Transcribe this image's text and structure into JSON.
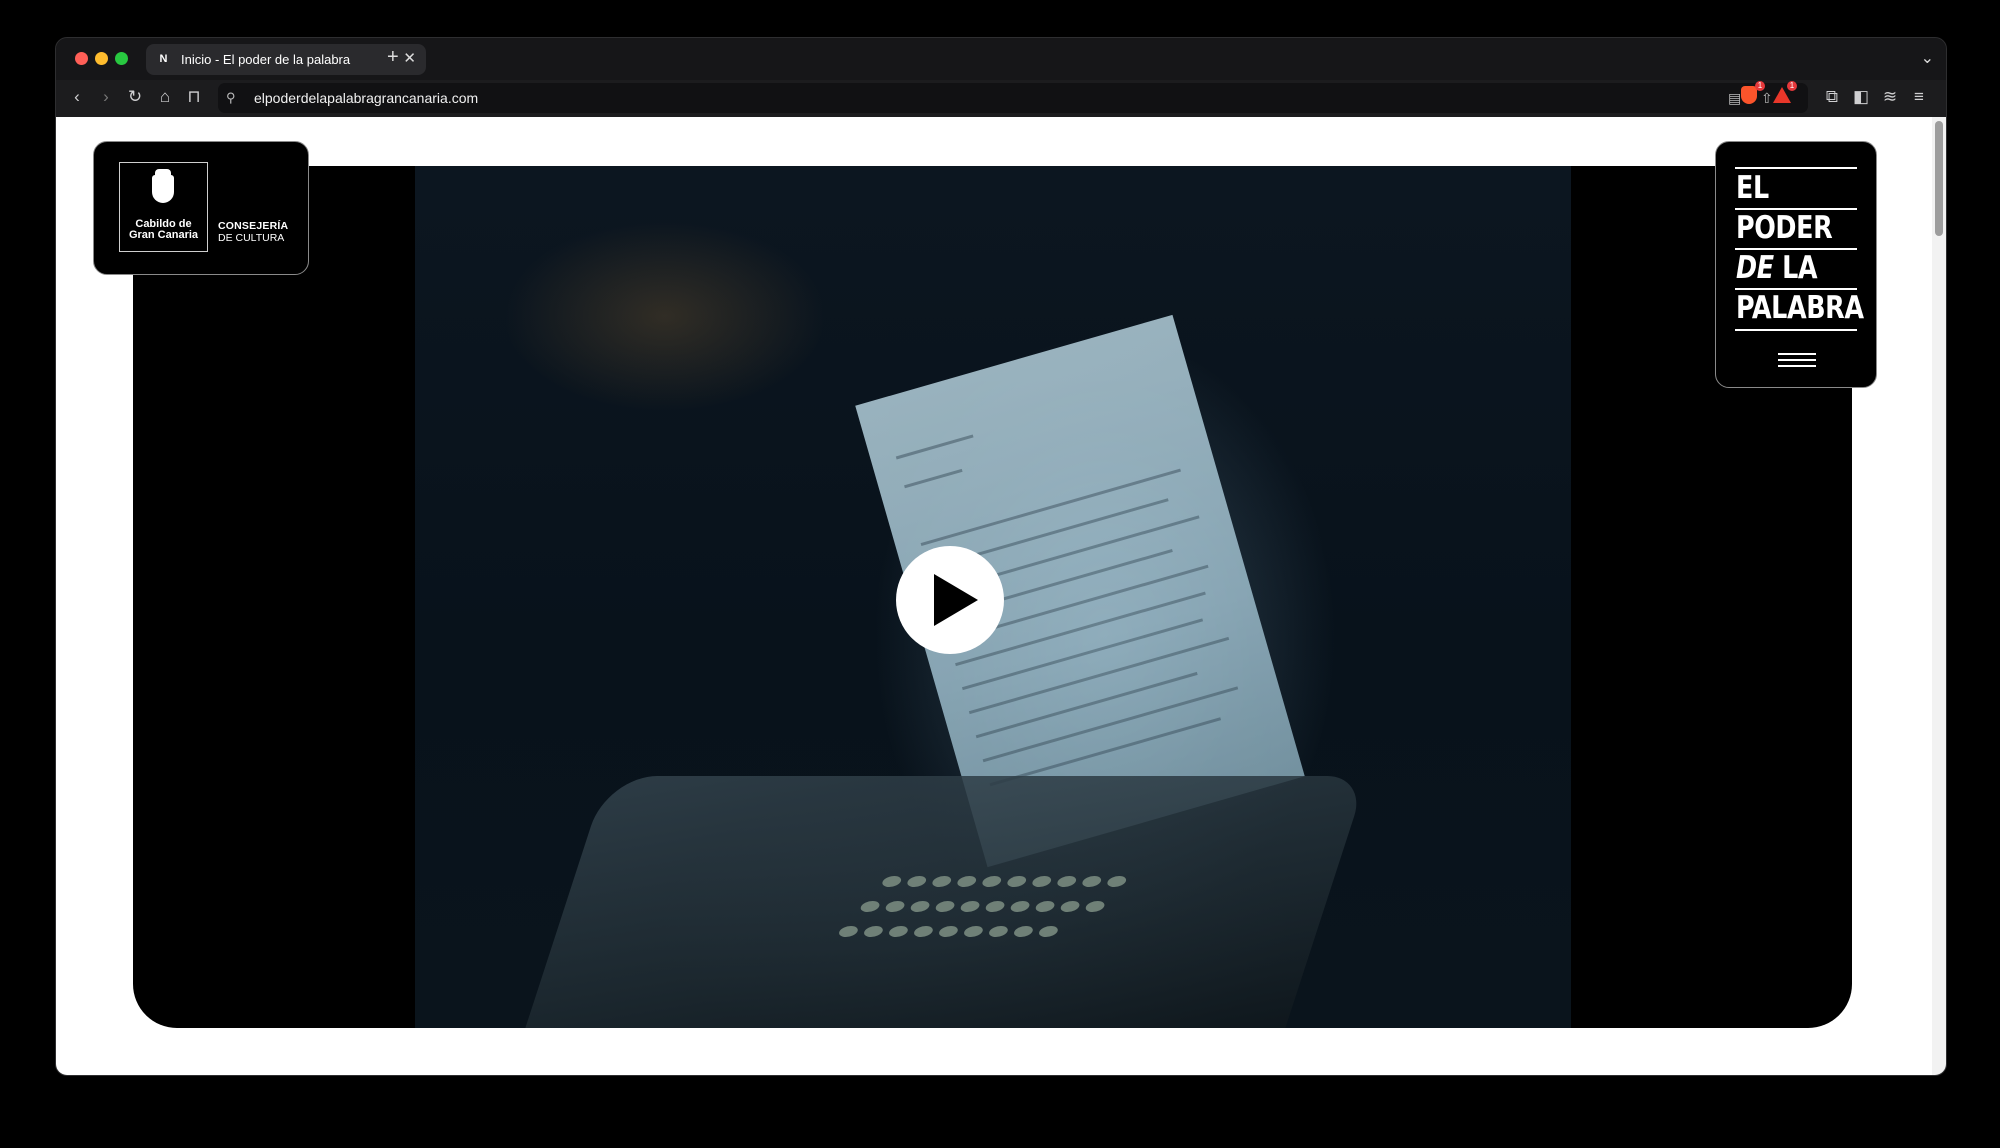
{
  "browser": {
    "tab": {
      "favicon": "N",
      "title": "Inicio - El poder de la palabra"
    },
    "url": "elpoderdelapalabragrancanaria.com",
    "brave_shields_count": "1",
    "brave_rewards_count": "1",
    "icons": [
      "back-icon",
      "forward-icon",
      "reload-icon",
      "home-icon",
      "bookmark-icon",
      "site-info-icon",
      "reader-mode-icon",
      "share-icon",
      "brave-shields-icon",
      "brave-rewards-icon",
      "extensions-icon",
      "sidebar-icon",
      "leo-icon",
      "menu-icon"
    ]
  },
  "header": {
    "logo": {
      "line1": "Cabildo de",
      "line2": "Gran Canaria",
      "dept_line1": "CONSEJERÍA",
      "dept_line2": "DE CULTURA"
    },
    "brand": {
      "line1": "EL",
      "line2": "PODER",
      "line3_italic": "DE",
      "line3": "LA",
      "line4": "PALABRA"
    }
  },
  "hero": {
    "media": "video-still",
    "play_icon": "play-icon"
  }
}
